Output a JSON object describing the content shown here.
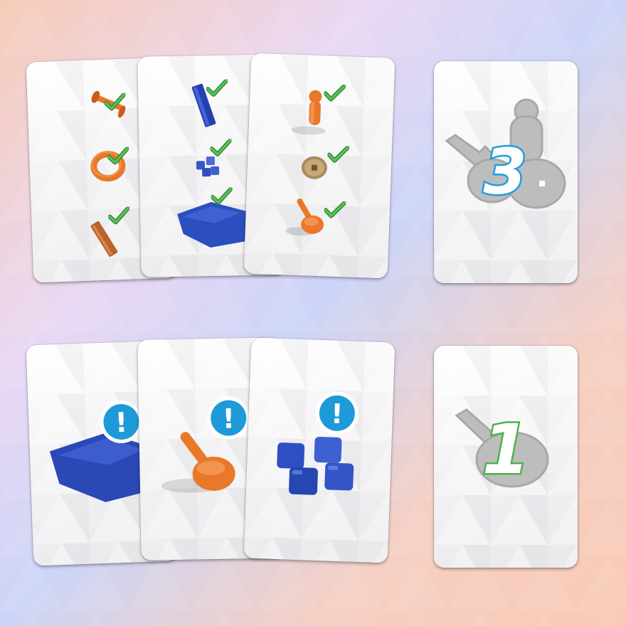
{
  "colors": {
    "orange": "#e9782a",
    "blue": "#2c4fbf",
    "check": "#3aa83a",
    "alert_blue": "#1f9ad8",
    "silhouette": "#bcbcbc",
    "count_3": "#1e9de0",
    "count_1": "#4fb04a"
  },
  "top_row": {
    "cards": [
      {
        "items": [
          "spinning-top-handle",
          "ring",
          "wooden-plank"
        ],
        "marks": [
          "check",
          "check",
          "check"
        ]
      },
      {
        "items": [
          "blue-bar",
          "ice-cubes",
          "blue-cloth"
        ],
        "marks": [
          "check",
          "check",
          "check"
        ]
      },
      {
        "items": [
          "pawn",
          "coin",
          "spinning-top"
        ],
        "marks": [
          "check",
          "check",
          "check"
        ]
      }
    ],
    "counter": {
      "value": "3",
      "silhouettes": [
        "spinning-top",
        "pawn",
        "coin"
      ]
    }
  },
  "bottom_row": {
    "cards": [
      {
        "item": "blue-cloth",
        "badge": "!"
      },
      {
        "item": "spinning-top",
        "badge": "!"
      },
      {
        "item": "ice-cubes",
        "badge": "!"
      }
    ],
    "counter": {
      "value": "1",
      "silhouettes": [
        "spinning-top"
      ]
    }
  }
}
